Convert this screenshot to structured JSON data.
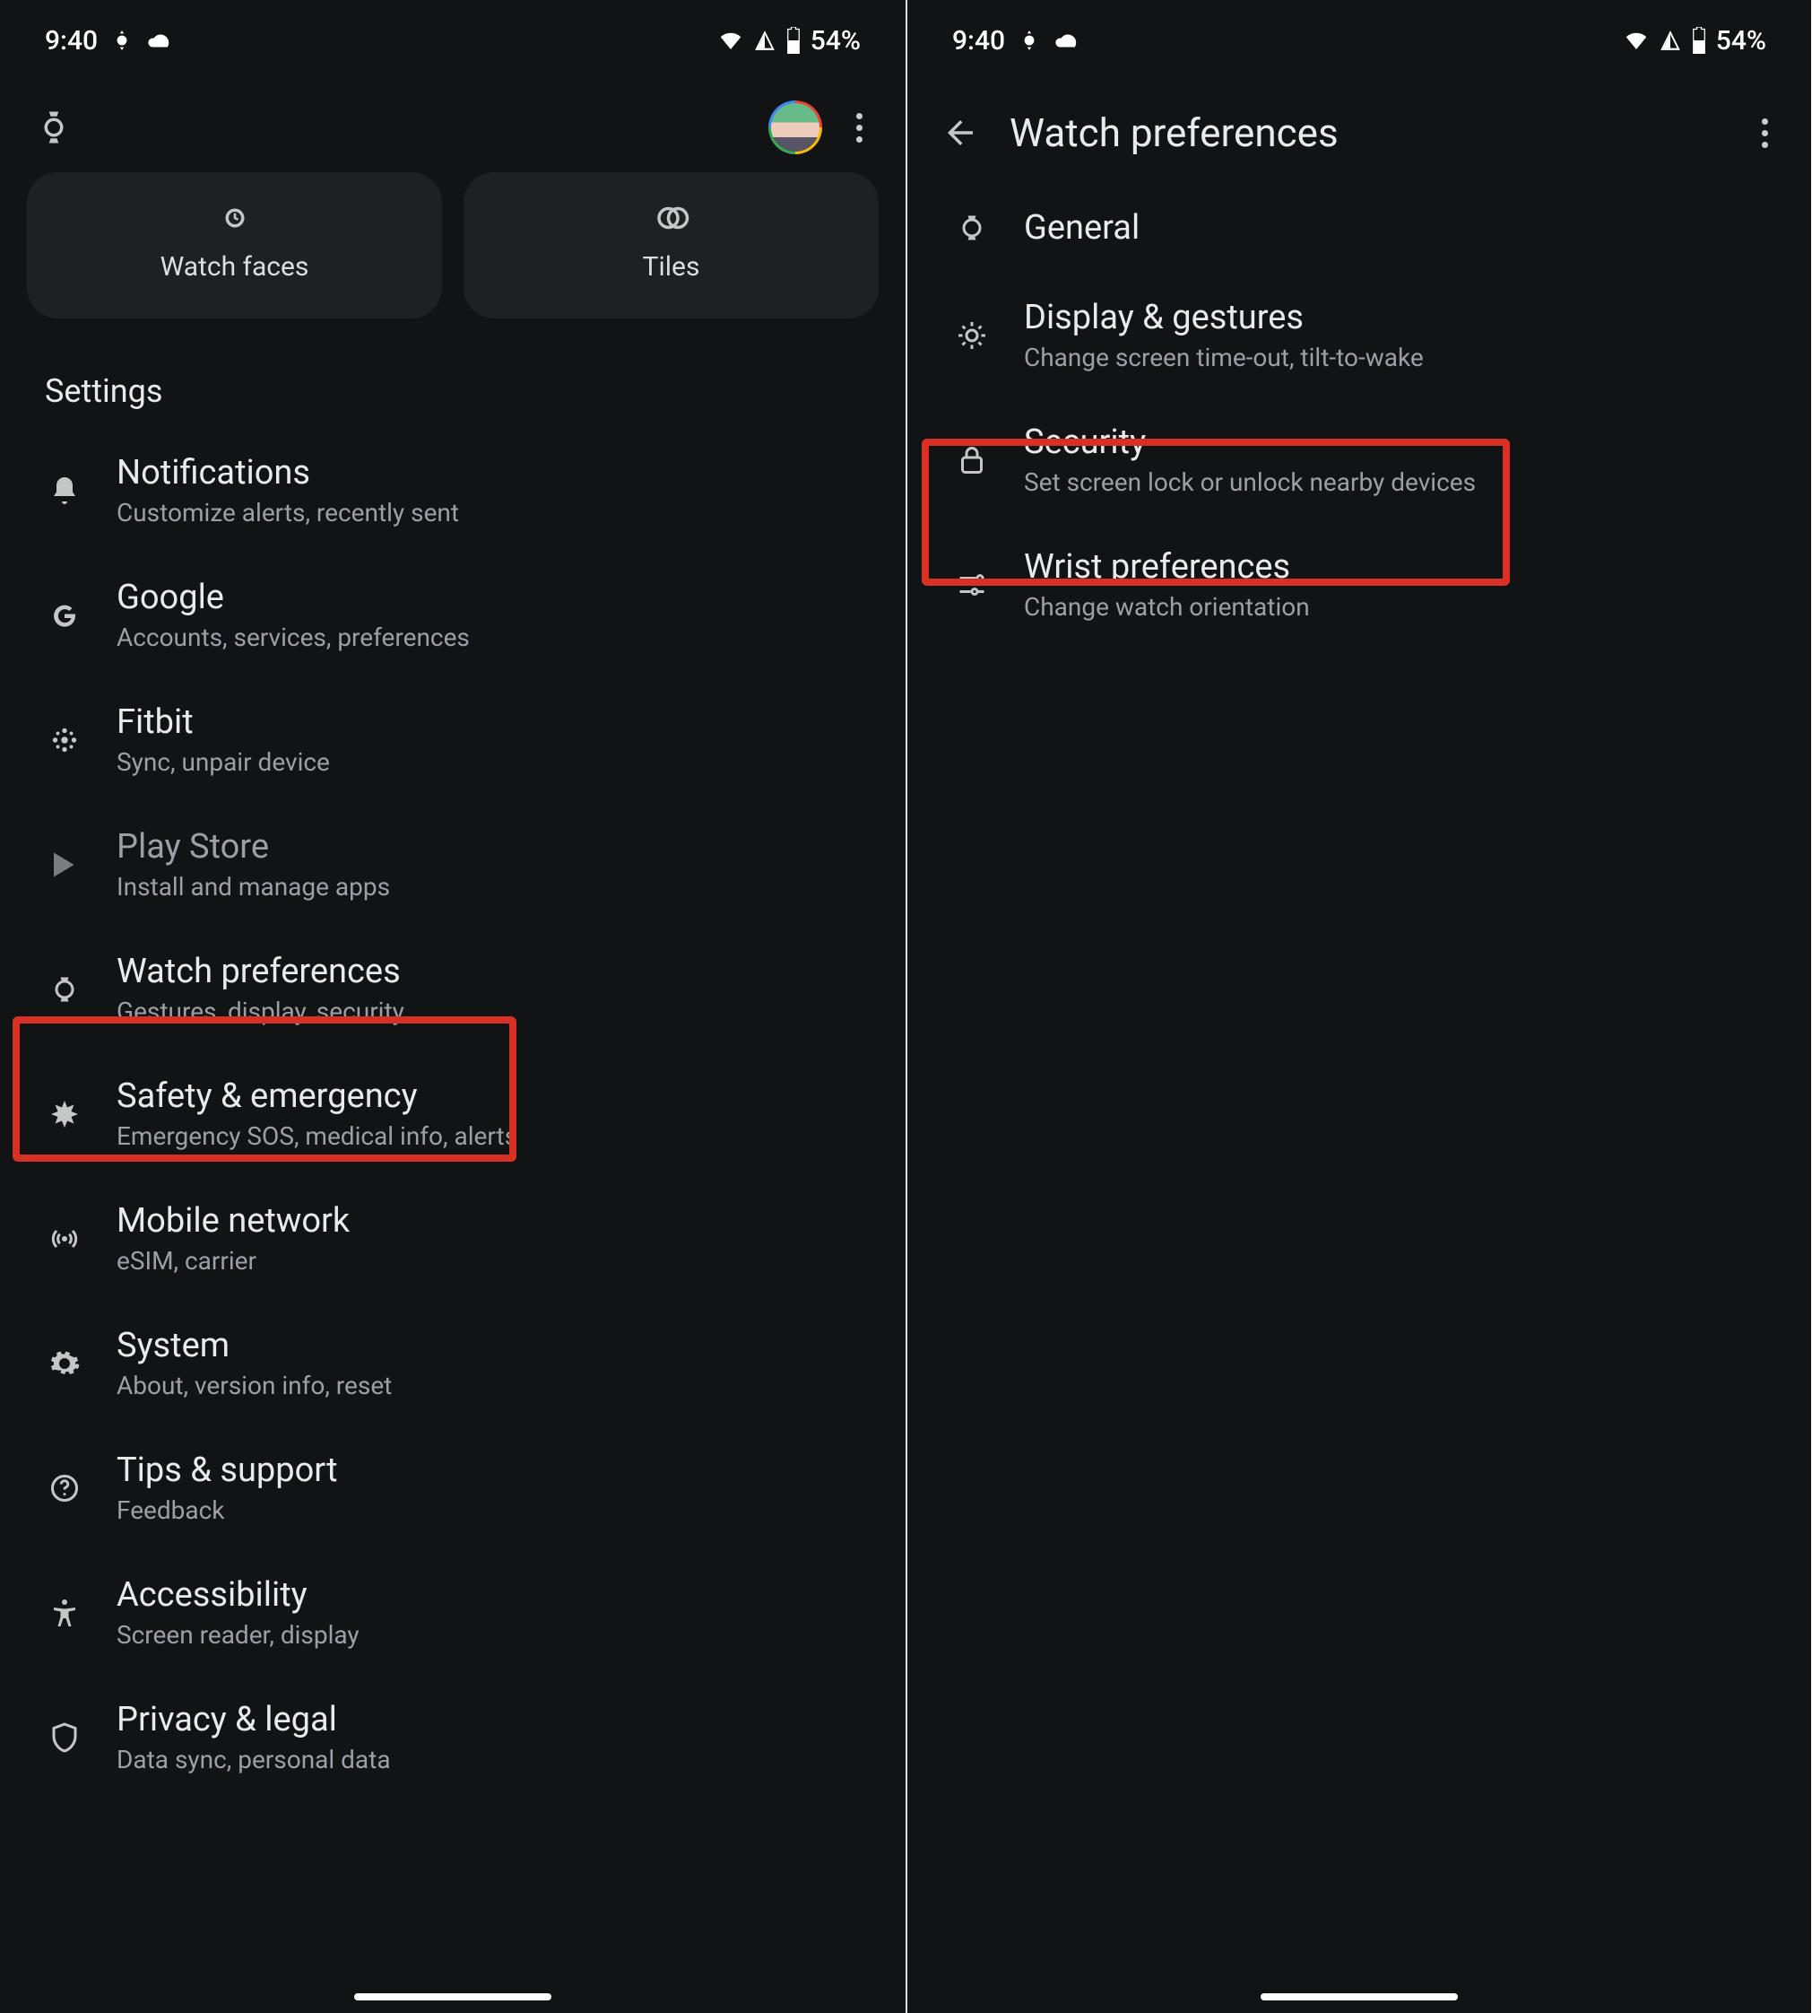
{
  "status": {
    "time": "9:40",
    "battery": "54%"
  },
  "left": {
    "tabs": {
      "watch_faces": "Watch faces",
      "tiles": "Tiles"
    },
    "section": "Settings",
    "items": [
      {
        "title": "Notifications",
        "sub": "Customize alerts, recently sent"
      },
      {
        "title": "Google",
        "sub": "Accounts, services, preferences"
      },
      {
        "title": "Fitbit",
        "sub": "Sync, unpair device"
      },
      {
        "title": "Play Store",
        "sub": "Install and manage apps"
      },
      {
        "title": "Watch preferences",
        "sub": "Gestures, display, security"
      },
      {
        "title": "Safety & emergency",
        "sub": "Emergency SOS, medical info, alerts"
      },
      {
        "title": "Mobile network",
        "sub": "eSIM, carrier"
      },
      {
        "title": "System",
        "sub": "About, version info, reset"
      },
      {
        "title": "Tips & support",
        "sub": "Feedback"
      },
      {
        "title": "Accessibility",
        "sub": "Screen reader, display"
      },
      {
        "title": "Privacy & legal",
        "sub": "Data sync, personal data"
      }
    ]
  },
  "right": {
    "title": "Watch preferences",
    "items": [
      {
        "title": "General",
        "sub": ""
      },
      {
        "title": "Display & gestures",
        "sub": "Change screen time-out, tilt-to-wake"
      },
      {
        "title": "Security",
        "sub": "Set screen lock or unlock nearby devices"
      },
      {
        "title": "Wrist preferences",
        "sub": "Change watch orientation"
      }
    ]
  }
}
